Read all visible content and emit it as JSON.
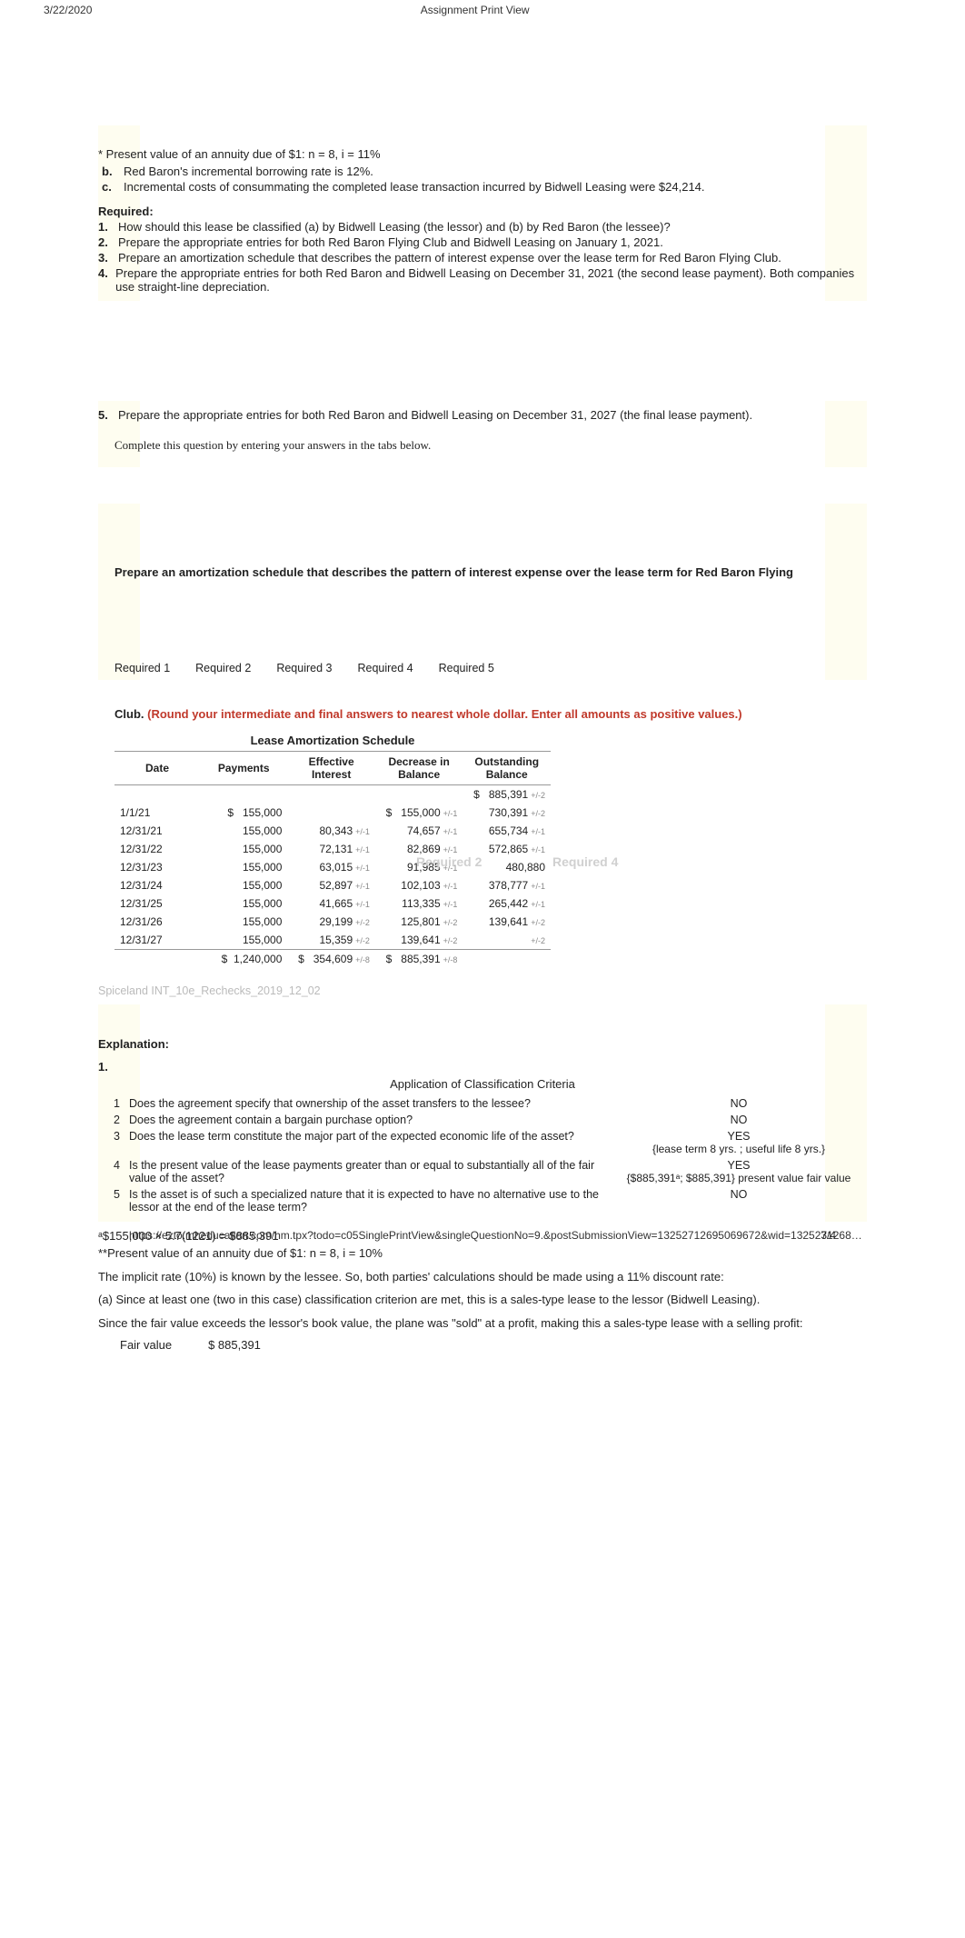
{
  "header": {
    "date": "3/22/2020",
    "title": "Assignment Print View"
  },
  "pvnote": "* Present value of an annuity due of $1: n = 8, i = 11%",
  "facts": {
    "b": "Red Baron's incremental borrowing rate is 12%.",
    "c": "Incremental costs of consummating the completed lease transaction incurred by Bidwell Leasing were $24,214."
  },
  "required_label": "Required:",
  "required": [
    "How should this lease be classified (a) by Bidwell Leasing (the lessor) and (b) by Red Baron (the lessee)?",
    "Prepare the appropriate entries for both Red Baron Flying Club and Bidwell Leasing on January 1, 2021.",
    "Prepare an amortization schedule that describes the pattern of interest expense over the lease term for Red Baron Flying Club.",
    "Prepare the appropriate entries for both Red Baron and Bidwell Leasing on December 31, 2021 (the second lease payment). Both companies use straight-line depreciation."
  ],
  "required5": "Prepare the appropriate entries for both Red Baron and Bidwell Leasing on December 31, 2027 (the final lease payment).",
  "tabs_instr": "Complete this question by entering your answers in the tabs below.",
  "tabs": [
    "Required 1",
    "Required 2",
    "Required 3",
    "Required 4",
    "Required 5"
  ],
  "schedule_instr_bold": "Prepare an amortization schedule that describes the pattern of interest expense over the lease term for Red Baron Flying",
  "club_prefix": "Club. ",
  "schedule_instr_red": "(Round your intermediate and final answers to nearest whole dollar. Enter all amounts as positive values.)",
  "amort": {
    "title": "Lease Amortization Schedule",
    "headers": [
      "Date",
      "Payments",
      "Effective Interest",
      "Decrease in Balance",
      "Outstanding Balance"
    ],
    "tol": "+/-1",
    "tol2": "+/-2",
    "tol8": "+/-8",
    "initial_balance": "885,391",
    "rows": [
      {
        "date": "1/1/21",
        "pay": "155,000",
        "int": "",
        "dec": "155,000",
        "bal": "730,391",
        "tb": "+/-2"
      },
      {
        "date": "12/31/21",
        "pay": "155,000",
        "int": "80,343",
        "dec": "74,657",
        "bal": "655,734",
        "tb": "+/-1"
      },
      {
        "date": "12/31/22",
        "pay": "155,000",
        "int": "72,131",
        "dec": "82,869",
        "bal": "572,865",
        "tb": "+/-1"
      },
      {
        "date": "12/31/23",
        "pay": "155,000",
        "int": "63,015",
        "dec": "91,985",
        "bal": "480,880",
        "tb": ""
      },
      {
        "date": "12/31/24",
        "pay": "155,000",
        "int": "52,897",
        "dec": "102,103",
        "bal": "378,777",
        "tb": "+/-1"
      },
      {
        "date": "12/31/25",
        "pay": "155,000",
        "int": "41,665",
        "dec": "113,335",
        "bal": "265,442",
        "tb": "+/-1"
      },
      {
        "date": "12/31/26",
        "pay": "155,000",
        "int": "29,199",
        "dec": "125,801",
        "bal": "139,641",
        "tb": "+/-2"
      },
      {
        "date": "12/31/27",
        "pay": "155,000",
        "int": "15,359",
        "dec": "139,641",
        "bal": "",
        "tb": "+/-2"
      }
    ],
    "totals": {
      "pay": "1,240,000",
      "int": "354,609",
      "dec": "885,391"
    }
  },
  "watermark1": "Required 2",
  "watermark2": "Required 4",
  "rechecks": "Spiceland INT_10e_Rechecks_2019_12_02",
  "explanation_label": "Explanation:",
  "one_label": "1.",
  "criteria_title": "Application of Classification Criteria",
  "criteria": [
    {
      "n": "1",
      "q": "Does the agreement specify that ownership of the asset transfers to the lessee?",
      "a": "NO"
    },
    {
      "n": "2",
      "q": "Does the agreement contain a bargain purchase option?",
      "a": "NO"
    },
    {
      "n": "3",
      "q": "Does the lease term constitute the major part of the expected economic life of the asset?",
      "a": "YES",
      "sub": "{lease term 8 yrs. ; useful life 8 yrs.}"
    },
    {
      "n": "4",
      "q": "Is the present value of the lease payments greater than or equal to substantially all of the fair value of the asset?",
      "a": "YES",
      "sub": "{$885,391ᵃ; $885,391} present value fair value"
    },
    {
      "n": "5",
      "q": "Is the asset is of such a specialized nature that it is expected to have no alternative use to the lessor at the end of the lease term?",
      "a": "NO"
    }
  ],
  "calc_line": "ᵃ$155,000 × 5.7(1221) = $885,391",
  "pv_note2": "**Present value of an annuity due of $1: n = 8, i = 10%",
  "para1": "The implicit rate (10%) is known by the lessee. So, both parties' calculations should be made using a 11% discount rate:",
  "para2": "(a) Since at least one (two in this case) classification criterion are met, this is a sales-type lease to the lessor (Bidwell Leasing).",
  "para3": "Since the fair value exceeds the lessor's book value, the plane was \"sold\" at a profit, making this a sales-type lease with a selling profit:",
  "fairvalue_label": "Fair value",
  "fairvalue_amt": "$ 885,391",
  "footer_url": "https://ezto.mheducation.com/hm.tpx?todo=c05SinglePrintView&singleQuestionNo=9.&postSubmissionView=13252712695069672&wid=1325271268…",
  "footer_page": "3/4"
}
